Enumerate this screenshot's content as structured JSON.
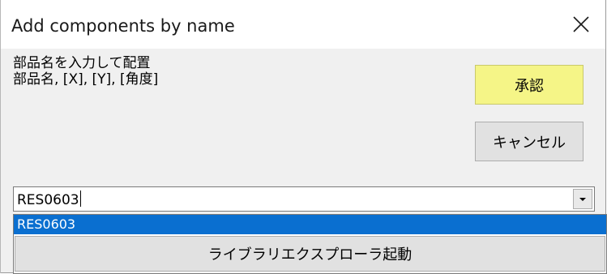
{
  "window": {
    "title": "Add components by name",
    "close_icon": "close-icon"
  },
  "instructions": {
    "line1": "部品名を入力して配置",
    "line2": "部品名, [X], [Y], [角度]"
  },
  "buttons": {
    "ok_label": "承認",
    "cancel_label": "キャンセル"
  },
  "combo": {
    "value": "RES0603",
    "arrow_icon": "chevron-down-icon"
  },
  "dropdown": {
    "items": [
      "RES0603"
    ],
    "launch_label": "ライブラリエクスプローラ起動"
  },
  "colors": {
    "ok_button": "#f5f587",
    "selection": "#0a6fd0"
  }
}
